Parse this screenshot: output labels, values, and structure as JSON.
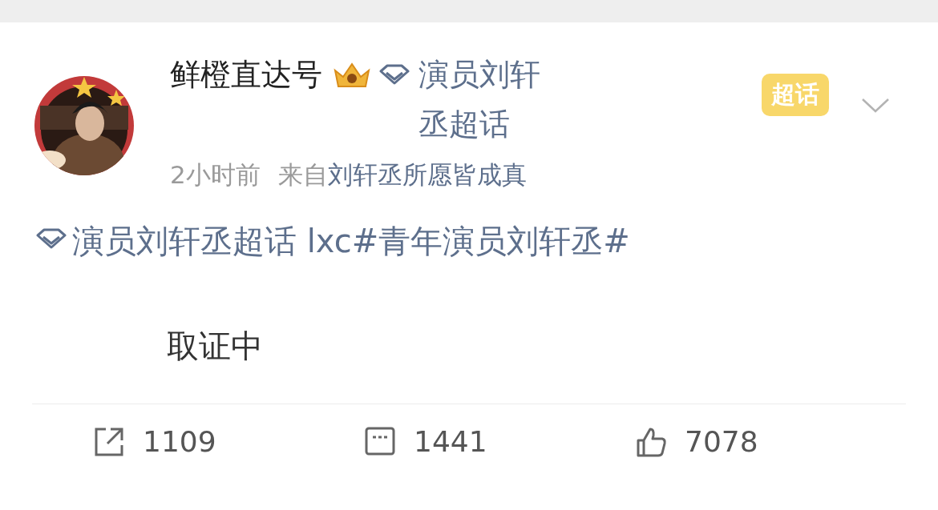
{
  "post": {
    "author": "鲜橙直达号",
    "topic": "演员刘轩丞超话",
    "time": "2小时前",
    "source_prefix": "来自",
    "source": "刘轩丞所愿皆成真",
    "badge": "超话",
    "body": [
      {
        "kind": "topic",
        "text": "演员刘轩丞超话"
      },
      {
        "kind": "text",
        "text": " lxc"
      },
      {
        "kind": "hashtag",
        "text": "#青年演员刘轩丞#"
      }
    ],
    "extra": "取证中"
  },
  "actions": [
    {
      "kind": "repost",
      "count": "1109"
    },
    {
      "kind": "comment",
      "count": "1441"
    },
    {
      "kind": "like",
      "count": "7078"
    }
  ]
}
